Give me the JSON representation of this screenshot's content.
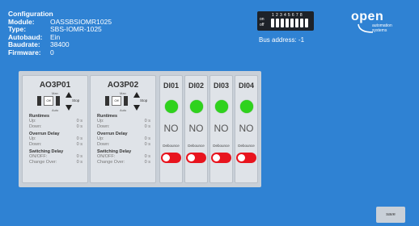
{
  "config": {
    "title": "Configuration",
    "fields": [
      {
        "label": "Module:",
        "value": "OASSBSIOMR1025"
      },
      {
        "label": "Type:",
        "value": "SBS-IOMR-1025"
      },
      {
        "label": "Autobaud:",
        "value": "Ein"
      },
      {
        "label": "Baudrate:",
        "value": "38400"
      },
      {
        "label": "Firmware:",
        "value": "0"
      }
    ]
  },
  "dip": {
    "numbers": "12345678",
    "on_label": "on",
    "off_label": "off",
    "bus_address": "Bus address: -1"
  },
  "logo": {
    "brand": "open",
    "line1": "automation",
    "line2": "systems"
  },
  "analog_outputs": [
    {
      "name": "AO3P01",
      "man": "Man",
      "off": "Off",
      "auto": "Auto",
      "stop": "Stop",
      "runtimes_title": "Runtimes",
      "up_label": "Up:",
      "up_value": "0 s",
      "down_label": "Down:",
      "down_value": "0 s",
      "overrun_title": "Overrun Delay",
      "or_up_label": "Up:",
      "or_up_value": "0 s",
      "or_down_label": "Down:",
      "or_down_value": "0 s",
      "switching_title": "Switching Delay",
      "onoff_label": "ON/OFF:",
      "onoff_value": "0 s",
      "change_label": "Change Over:",
      "change_value": "0 s"
    },
    {
      "name": "AO3P02",
      "man": "Man",
      "off": "Off",
      "auto": "Auto",
      "stop": "Stop",
      "runtimes_title": "Runtimes",
      "up_label": "Up:",
      "up_value": "0 s",
      "down_label": "Down:",
      "down_value": "0 s",
      "overrun_title": "Overrun Delay",
      "or_up_label": "Up:",
      "or_up_value": "0 s",
      "or_down_label": "Down:",
      "or_down_value": "0 s",
      "switching_title": "Switching Delay",
      "onoff_label": "ON/OFF:",
      "onoff_value": "0 s",
      "change_label": "Change Over:",
      "change_value": "0 s"
    }
  ],
  "digital_inputs": [
    {
      "name": "DI01",
      "state": "NO",
      "debounce": "Debounce"
    },
    {
      "name": "DI02",
      "state": "NO",
      "debounce": "Debounce"
    },
    {
      "name": "DI03",
      "state": "NO",
      "debounce": "Debounce"
    },
    {
      "name": "DI04",
      "state": "NO",
      "debounce": "Debounce"
    }
  ],
  "colors": {
    "background": "#2f82d3",
    "led_on": "#2fd21d",
    "toggle_off": "#e8141e"
  },
  "save_label": "save"
}
